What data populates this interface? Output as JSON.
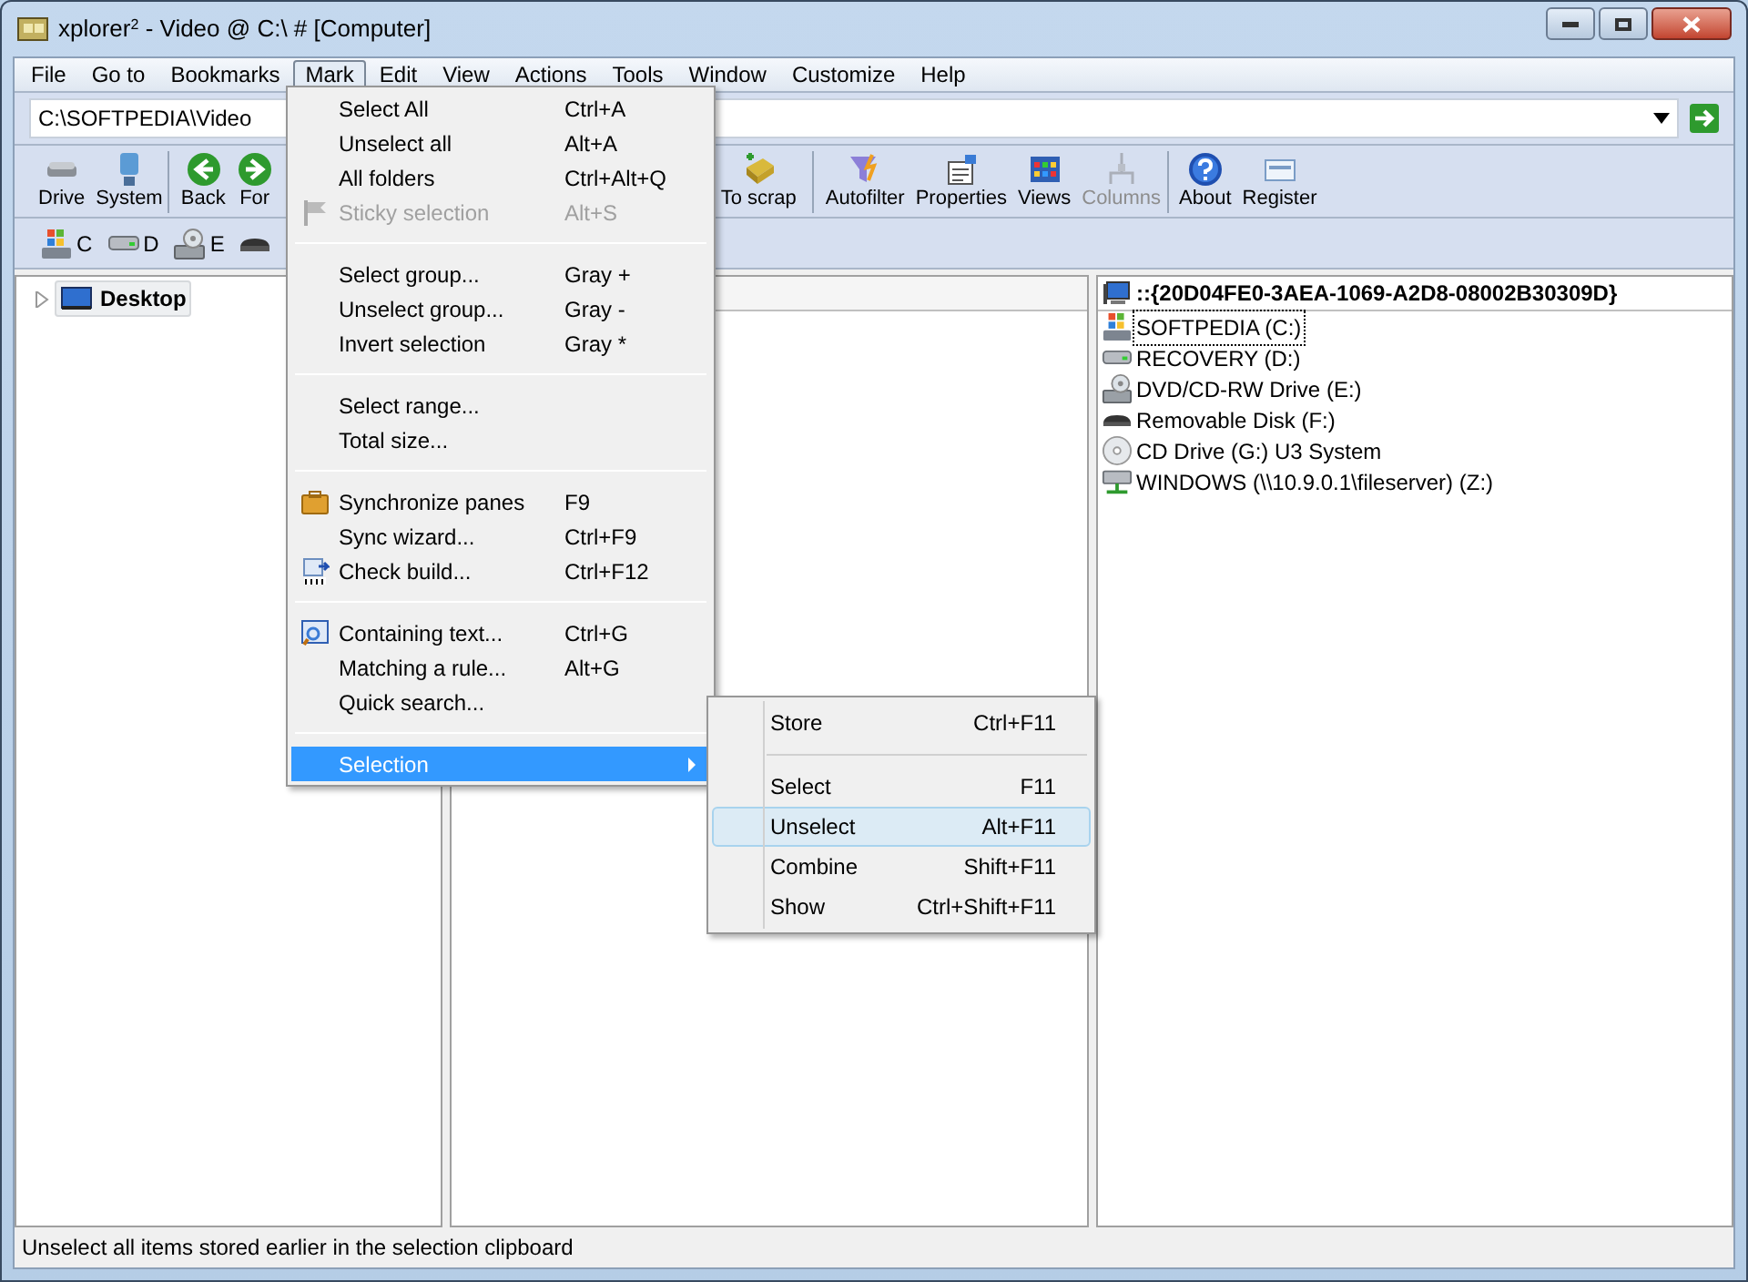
{
  "window": {
    "title": "xplorer",
    "title_sup": "2",
    "title_rest": " - Video @ C:\\ # [Computer]"
  },
  "menubar": [
    {
      "label": "File",
      "selected": false
    },
    {
      "label": "Go to",
      "selected": false
    },
    {
      "label": "Bookmarks",
      "selected": false
    },
    {
      "label": "Mark",
      "selected": true
    },
    {
      "label": "Edit",
      "selected": false
    },
    {
      "label": "View",
      "selected": false
    },
    {
      "label": "Actions",
      "selected": false
    },
    {
      "label": "Tools",
      "selected": false
    },
    {
      "label": "Window",
      "selected": false
    },
    {
      "label": "Customize",
      "selected": false
    },
    {
      "label": "Help",
      "selected": false
    }
  ],
  "address": {
    "value": "C:\\SOFTPEDIA\\Video"
  },
  "toolbar": [
    [
      {
        "label": "Drive",
        "kind": "drive",
        "disabled": false
      },
      {
        "label": "System",
        "kind": "system",
        "disabled": false
      }
    ],
    [
      {
        "label": "Back",
        "kind": "back",
        "disabled": false
      },
      {
        "label": "For",
        "kind": "forward",
        "disabled": false
      }
    ],
    [
      {
        "label": "To scrap",
        "kind": "scrap",
        "disabled": false
      }
    ],
    [
      {
        "label": "Autofilter",
        "kind": "filter",
        "disabled": false
      },
      {
        "label": "Properties",
        "kind": "properties",
        "disabled": false
      },
      {
        "label": "Views",
        "kind": "views",
        "disabled": false
      },
      {
        "label": "Columns",
        "kind": "columns",
        "disabled": true
      }
    ],
    [
      {
        "label": "About",
        "kind": "about",
        "disabled": false
      },
      {
        "label": "Register",
        "kind": "register",
        "disabled": false
      }
    ]
  ],
  "drivebar": [
    {
      "label": "C",
      "kind": "windows"
    },
    {
      "label": "D",
      "kind": "hdd"
    },
    {
      "label": "E",
      "kind": "dvd"
    },
    {
      "kind": "removable"
    }
  ],
  "left_pane": {
    "tree": [
      {
        "label": "Desktop",
        "expanded": false
      }
    ]
  },
  "right_pane": {
    "header": "::{20D04FE0-3AEA-1069-A2D8-08002B30309D}",
    "items": [
      {
        "label": "SOFTPEDIA (C:)",
        "kind": "windows",
        "selected": true
      },
      {
        "label": "RECOVERY (D:)",
        "kind": "hdd",
        "selected": false
      },
      {
        "label": "DVD/CD-RW Drive (E:)",
        "kind": "dvd",
        "selected": false
      },
      {
        "label": "Removable Disk (F:)",
        "kind": "removable",
        "selected": false
      },
      {
        "label": "CD Drive (G:) U3 System",
        "kind": "cd",
        "selected": false
      },
      {
        "label": "WINDOWS (\\\\10.9.0.1\\fileserver) (Z:)",
        "kind": "network",
        "selected": false
      }
    ]
  },
  "mark_menu": [
    {
      "kind": "item",
      "label": "Select All",
      "shortcut": "Ctrl+A",
      "disabled": false,
      "selected": false
    },
    {
      "kind": "item",
      "label": "Unselect all",
      "shortcut": "Alt+A",
      "disabled": false,
      "selected": false
    },
    {
      "kind": "item",
      "label": "All folders",
      "shortcut": "Ctrl+Alt+Q",
      "disabled": false,
      "selected": false
    },
    {
      "kind": "flag",
      "label": "Sticky selection",
      "shortcut": "Alt+S",
      "disabled": true,
      "selected": false
    },
    {
      "kind": "separator"
    },
    {
      "kind": "item",
      "label": "Select group...",
      "shortcut": "Gray +",
      "disabled": false,
      "selected": false
    },
    {
      "kind": "item",
      "label": "Unselect group...",
      "shortcut": "Gray -",
      "disabled": false,
      "selected": false
    },
    {
      "kind": "item",
      "label": "Invert selection",
      "shortcut": "Gray *",
      "disabled": false,
      "selected": false
    },
    {
      "kind": "separator"
    },
    {
      "kind": "item",
      "label": "Select range...",
      "disabled": false,
      "selected": false
    },
    {
      "kind": "item",
      "label": "Total size...",
      "disabled": false,
      "selected": false
    },
    {
      "kind": "separator"
    },
    {
      "kind": "sync",
      "label": "Synchronize panes",
      "shortcut": "F9",
      "disabled": false,
      "selected": false
    },
    {
      "kind": "item",
      "label": "Sync wizard...",
      "shortcut": "Ctrl+F9",
      "disabled": false,
      "selected": false
    },
    {
      "kind": "build",
      "label": "Check build...",
      "shortcut": "Ctrl+F12",
      "disabled": false,
      "selected": false
    },
    {
      "kind": "separator"
    },
    {
      "kind": "search",
      "label": "Containing text...",
      "shortcut": "Ctrl+G",
      "disabled": false,
      "selected": false
    },
    {
      "kind": "item",
      "label": "Matching a rule...",
      "shortcut": "Alt+G",
      "disabled": false,
      "selected": false
    },
    {
      "kind": "item",
      "label": "Quick search...",
      "disabled": false,
      "selected": false
    },
    {
      "kind": "separator"
    },
    {
      "kind": "submenu",
      "label": "Selection",
      "disabled": false,
      "selected": true
    }
  ],
  "selection_submenu": [
    {
      "kind": "item",
      "label": "Store",
      "shortcut": "Ctrl+F11",
      "selected": false
    },
    {
      "kind": "separator"
    },
    {
      "kind": "item",
      "label": "Select",
      "shortcut": "F11",
      "selected": false
    },
    {
      "kind": "item",
      "label": "Unselect",
      "shortcut": "Alt+F11",
      "selected": true
    },
    {
      "kind": "item",
      "label": "Combine",
      "shortcut": "Shift+F11",
      "selected": false
    },
    {
      "kind": "item",
      "label": "Show",
      "shortcut": "Ctrl+Shift+F11",
      "selected": false
    }
  ],
  "status_bar": "Unselect all items stored earlier in the selection clipboard"
}
